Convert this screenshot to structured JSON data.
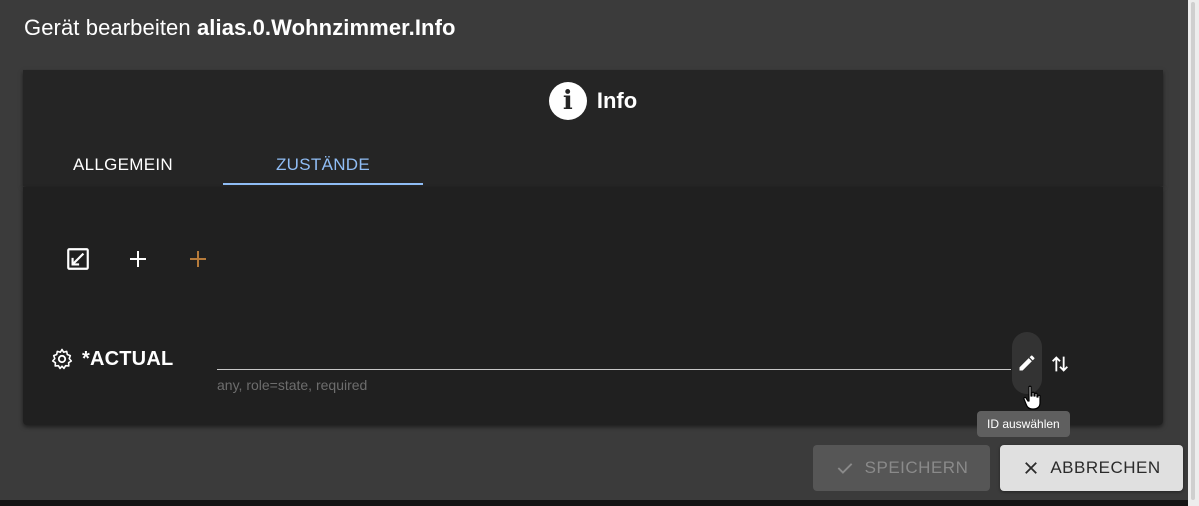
{
  "dialog": {
    "title_prefix": "Gerät bearbeiten",
    "title_id": "alias.0.Wohnzimmer.Info"
  },
  "header": {
    "icon": "info-circle-icon",
    "title": "Info"
  },
  "tabs": [
    {
      "label": "ALLGEMEIN",
      "active": false
    },
    {
      "label": "ZUSTÄNDE",
      "active": true
    }
  ],
  "toolbar": {
    "icons": [
      "edit-square-icon",
      "plus-icon",
      "plus-icon"
    ],
    "accent_plus_color": "#b57a3a"
  },
  "state": {
    "icon": "gear-icon",
    "name": "*ACTUAL",
    "id_value": "",
    "helper": "any, role=state, required"
  },
  "tooltip": {
    "text": "ID auswählen"
  },
  "actions": {
    "save_label": "SPEICHERN",
    "cancel_label": "ABBRECHEN"
  },
  "colors": {
    "accent": "#90bdf5",
    "dialog_bg": "#3b3b3b",
    "card_bg": "#202020"
  }
}
